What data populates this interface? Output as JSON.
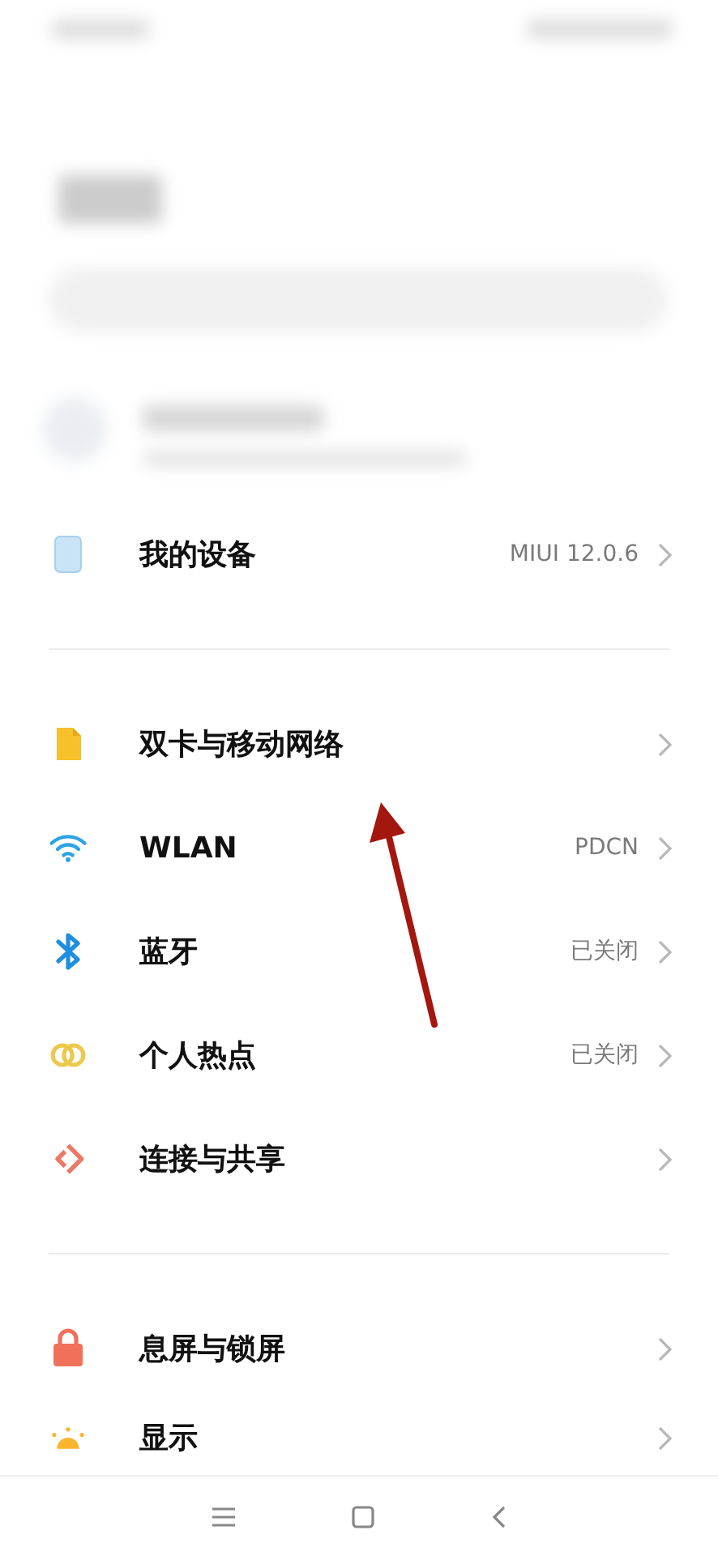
{
  "sections": [
    {
      "items": [
        {
          "label": "我的设备",
          "value": "MIUI 12.0.6"
        }
      ]
    },
    {
      "items": [
        {
          "label": "双卡与移动网络"
        },
        {
          "label": "WLAN",
          "value": "PDCN"
        },
        {
          "label": "蓝牙",
          "value": "已关闭"
        },
        {
          "label": "个人热点",
          "value": "已关闭"
        },
        {
          "label": "连接与共享"
        }
      ]
    },
    {
      "items": [
        {
          "label": "息屏与锁屏"
        },
        {
          "label": "显示"
        }
      ]
    }
  ]
}
